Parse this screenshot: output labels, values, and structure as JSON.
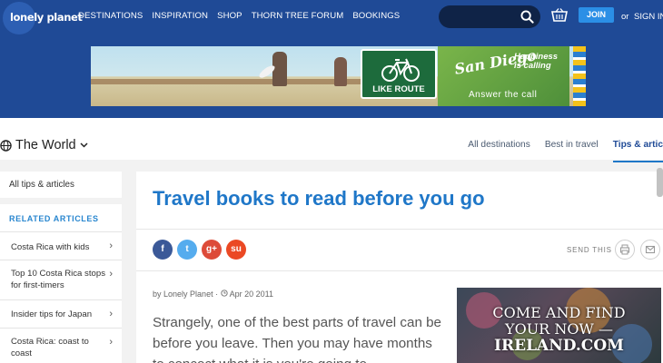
{
  "header": {
    "logo_text": "lonely planet",
    "nav": [
      "DESTINATIONS",
      "INSPIRATION",
      "SHOP",
      "THORN TREE FORUM",
      "BOOKINGS"
    ],
    "search_placeholder": "",
    "join_label": "JOIN",
    "or_label": "or",
    "signin_label": "SIGN IN"
  },
  "banner_ad": {
    "sign_label": "LIKE ROUTE",
    "brand": "San Diego",
    "tagline": "Happiness is calling",
    "cta": "Answer the call"
  },
  "world_bar": {
    "title": "The World",
    "tabs": [
      "All destinations",
      "Best in travel",
      "Tips & artic"
    ]
  },
  "sidebar": {
    "all_tips_label": "All tips & articles",
    "related_heading": "RELATED ARTICLES",
    "items": [
      "Costa Rica with kids",
      "Top 10 Costa Rica stops for first-timers",
      "Insider tips for Japan",
      "Costa Rica: coast to coast"
    ]
  },
  "article": {
    "title": "Travel books to read before you go",
    "share_icons": [
      "f",
      "t",
      "g+",
      "su"
    ],
    "send_this_label": "SEND THIS",
    "by_prefix": "by",
    "author": "Lonely Planet",
    "separator": "·",
    "date": "Apr 20 2011",
    "body": "Strangely, one of the best parts of travel can be before you leave. Then you may have months to concoct what it is you're going to"
  },
  "side_ad": {
    "line1": "COME AND FIND",
    "line2": "YOUR NOW —",
    "line3": "IRELAND.COM"
  },
  "colors": {
    "brand_blue": "#1f4a96",
    "accent_blue": "#1f77c8",
    "facebook": "#3b5998",
    "twitter": "#55acee",
    "google_plus": "#dd4b39",
    "stumbleupon": "#eb4924"
  }
}
